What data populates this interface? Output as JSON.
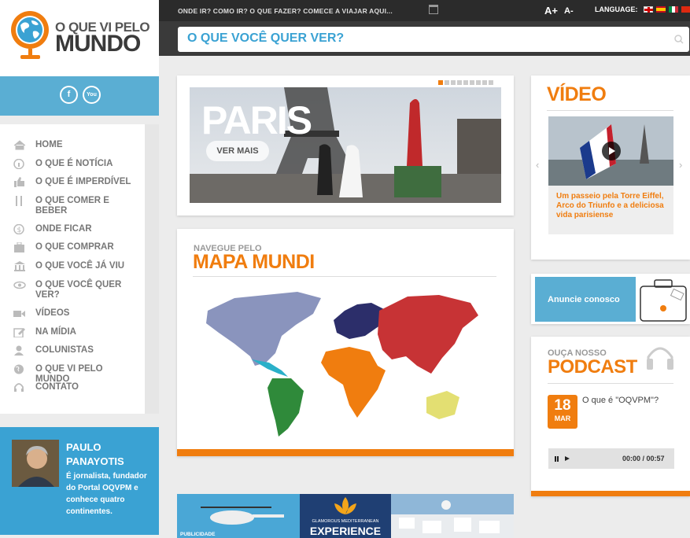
{
  "logo": {
    "line1": "O QUE VI PELO",
    "line2": "MUNDO"
  },
  "social": {
    "facebook": "f",
    "youtube": "You"
  },
  "nav": [
    {
      "label": "HOME",
      "icon": "home-icon"
    },
    {
      "label": "O QUE É NOTÍCIA",
      "icon": "info-icon"
    },
    {
      "label": "O QUE É IMPERDÍVEL",
      "icon": "thumbs-up-icon"
    },
    {
      "label": "O QUE COMER E BEBER",
      "icon": "cutlery-icon"
    },
    {
      "label": "ONDE FICAR",
      "icon": "dollar-icon"
    },
    {
      "label": "O QUE COMPRAR",
      "icon": "briefcase-icon"
    },
    {
      "label": "O QUE VOCÊ JÁ VIU",
      "icon": "bank-icon"
    },
    {
      "label": "O QUE VOCÊ QUER VER?",
      "icon": "eye-icon"
    },
    {
      "label": "VÍDEOS",
      "icon": "video-camera-icon"
    },
    {
      "label": "NA MÍDIA",
      "icon": "edit-icon"
    },
    {
      "label": "COLUNISTAS",
      "icon": "user-icon"
    },
    {
      "label": "O QUE VI PELO MUNDO",
      "icon": "globe-icon"
    },
    {
      "label": "CONTATO",
      "icon": "headset-icon"
    }
  ],
  "author": {
    "name1": "PAULO",
    "name2": "PANAYOTIS",
    "bio": "É jornalista, fundador do Portal OQVPM e conhece quatro continentes."
  },
  "topbar": {
    "links": "ONDE IR? COMO IR? O QUE FAZER? COMECE A VIAJAR AQUI...",
    "font_up": "A+",
    "font_down": "A-",
    "language_label": "LANGUAGE:"
  },
  "search": {
    "placeholder": "O QUE VOCÊ QUER VER?"
  },
  "slider": {
    "title": "PARIS",
    "button": "VER MAIS"
  },
  "map": {
    "subtitle": "NAVEGUE PELO",
    "title": "MAPA MUNDI"
  },
  "video": {
    "title": "VÍDEO",
    "caption": "Um passeio pela Torre Eiffel, Arco do Triunfo e a deliciosa vida parisiense"
  },
  "ad": {
    "label": "Anuncie conosco"
  },
  "podcast": {
    "subtitle": "OUÇA NOSSO",
    "title": "PODCAST",
    "day": "18",
    "month": "MAR",
    "episode": "O que é \"OQVPM\"?",
    "time": "00:00 / 00:57"
  },
  "banners": {
    "label": "PUBLICIDADE",
    "banner2_line1": "GLAMOROUS MEDITERRANEAN",
    "banner2_line2": "EXPERIENCE"
  },
  "colors": {
    "accent": "#f07d0f",
    "blue": "#3aa2d3"
  }
}
